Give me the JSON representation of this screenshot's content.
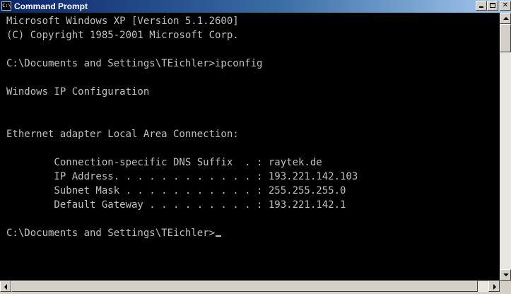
{
  "window": {
    "title": "Command Prompt",
    "icon_text": "C:\\",
    "icon": "console-app-icon"
  },
  "title_buttons": {
    "minimize": "minimize-icon",
    "maximize": "maximize-icon",
    "close": "close-icon"
  },
  "console": {
    "lines": [
      "Microsoft Windows XP [Version 5.1.2600]",
      "(C) Copyright 1985-2001 Microsoft Corp.",
      "",
      "C:\\Documents and Settings\\TEichler>ipconfig",
      "",
      "Windows IP Configuration",
      "",
      "",
      "Ethernet adapter Local Area Connection:",
      "",
      "        Connection-specific DNS Suffix  . : raytek.de",
      "        IP Address. . . . . . . . . . . . : 193.221.142.103",
      "        Subnet Mask . . . . . . . . . . . : 255.255.255.0",
      "        Default Gateway . . . . . . . . . : 193.221.142.1",
      "",
      "C:\\Documents and Settings\\TEichler>"
    ],
    "text_color": "#c0c0c0",
    "background_color": "#000000"
  },
  "colors": {
    "titlebar_start": "#0a246a",
    "titlebar_end": "#a6caf0",
    "chrome": "#d4d0c8"
  }
}
